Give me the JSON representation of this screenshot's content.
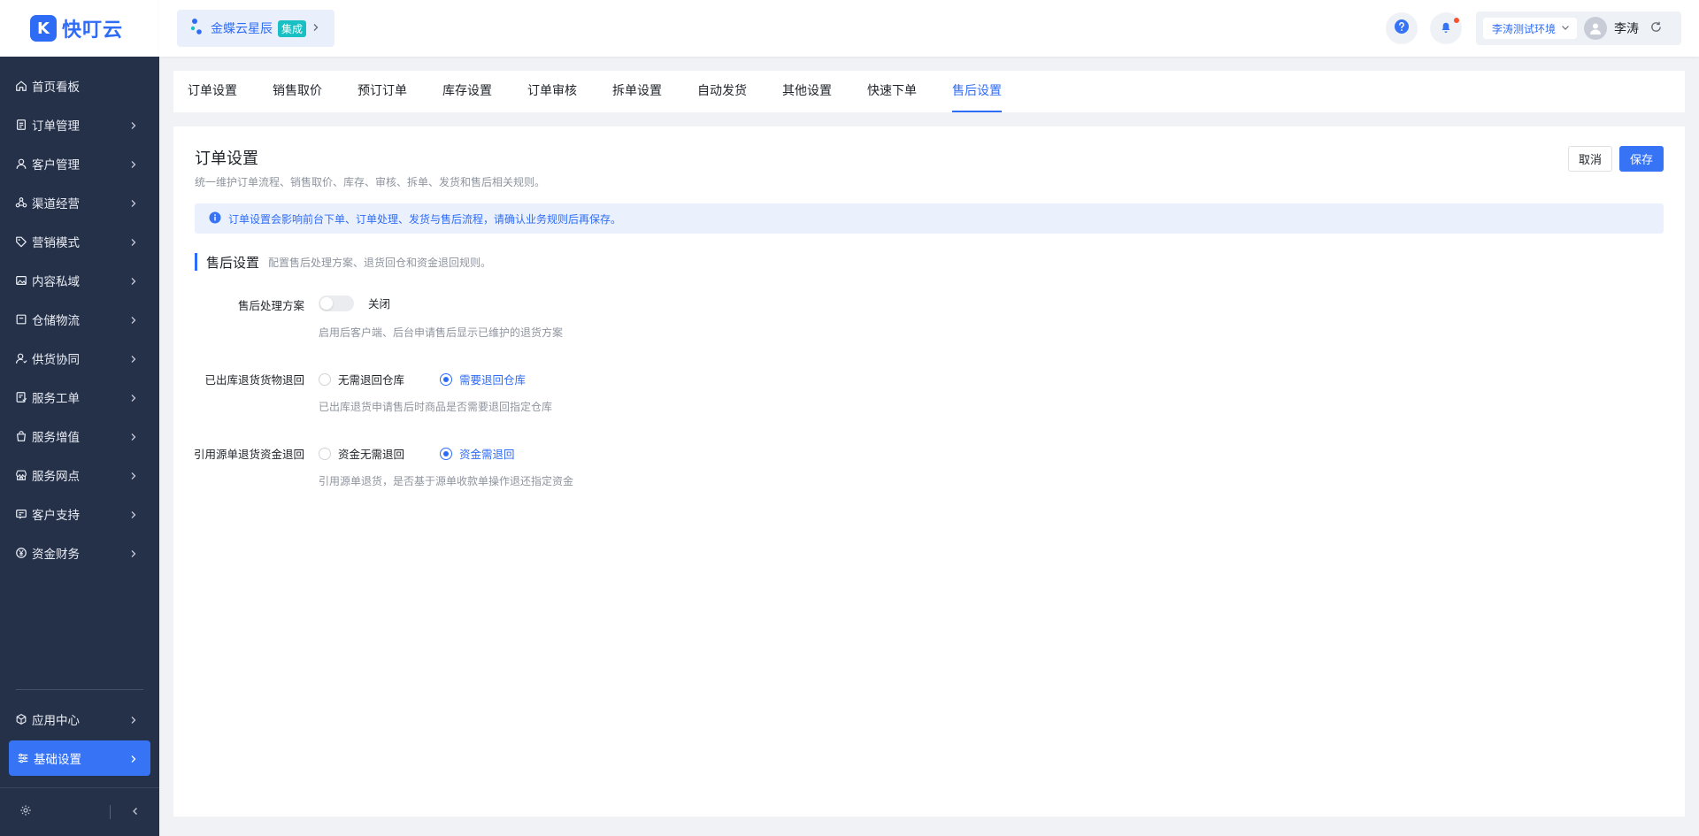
{
  "brand": {
    "name": "快叮云",
    "mark": "K"
  },
  "sidebar": {
    "items": [
      {
        "label": "首页看板",
        "icon": "home-icon",
        "has_children": false
      },
      {
        "label": "订单管理",
        "icon": "clipboard-icon",
        "has_children": true
      },
      {
        "label": "客户管理",
        "icon": "user-icon",
        "has_children": true
      },
      {
        "label": "渠道经营",
        "icon": "channel-icon",
        "has_children": true
      },
      {
        "label": "营销模式",
        "icon": "tag-icon",
        "has_children": true
      },
      {
        "label": "内容私域",
        "icon": "image-icon",
        "has_children": true
      },
      {
        "label": "仓储物流",
        "icon": "box-icon",
        "has_children": true
      },
      {
        "label": "供货协同",
        "icon": "supplier-icon",
        "has_children": true
      },
      {
        "label": "服务工单",
        "icon": "ticket-icon",
        "has_children": true
      },
      {
        "label": "服务增值",
        "icon": "bag-icon",
        "has_children": true
      },
      {
        "label": "服务网点",
        "icon": "store-icon",
        "has_children": true
      },
      {
        "label": "客户支持",
        "icon": "support-icon",
        "has_children": true
      },
      {
        "label": "资金财务",
        "icon": "yen-icon",
        "has_children": true
      }
    ],
    "bottom_items": [
      {
        "label": "应用中心",
        "icon": "cube-icon"
      },
      {
        "label": "基础设置",
        "icon": "sliders-icon",
        "active": true
      }
    ]
  },
  "header": {
    "biz_name": "金蝶云星辰",
    "biz_badge": "集成",
    "env_label": "李涛测试环境",
    "user_name": "李涛"
  },
  "tabs": [
    {
      "label": "订单设置"
    },
    {
      "label": "销售取价"
    },
    {
      "label": "预订订单"
    },
    {
      "label": "库存设置"
    },
    {
      "label": "订单审核"
    },
    {
      "label": "拆单设置"
    },
    {
      "label": "自动发货"
    },
    {
      "label": "其他设置"
    },
    {
      "label": "快速下单"
    },
    {
      "label": "售后设置",
      "active": true
    }
  ],
  "page": {
    "title": "订单设置",
    "desc": "统一维护订单流程、销售取价、库存、审核、拆单、发货和售后相关规则。",
    "cancel": "取消",
    "save": "保存",
    "alert": "订单设置会影响前台下单、订单处理、发货与售后流程，请确认业务规则后再保存。"
  },
  "section": {
    "title": "售后设置",
    "desc": "配置售后处理方案、退货回仓和资金退回规则。",
    "fields": [
      {
        "label": "售后处理方案",
        "type": "switch",
        "state_text": "关闭",
        "help": "启用后客户端、后台申请售后显示已维护的退货方案"
      },
      {
        "label": "已出库退货货物退回",
        "type": "radio",
        "options": [
          "无需退回仓库",
          "需要退回仓库"
        ],
        "selected": 1,
        "help": "已出库退货申请售后时商品是否需要退回指定仓库"
      },
      {
        "label": "引用源单退货资金退回",
        "type": "radio",
        "options": [
          "资金无需退回",
          "资金需退回"
        ],
        "selected": 1,
        "help": "引用源单退货，是否基于源单收款单操作退还指定资金"
      }
    ]
  },
  "colors": {
    "accent": "#3773f5",
    "sidebar_bg": "#253049",
    "badge": "#18c0c4",
    "notif": "#f5532d"
  }
}
